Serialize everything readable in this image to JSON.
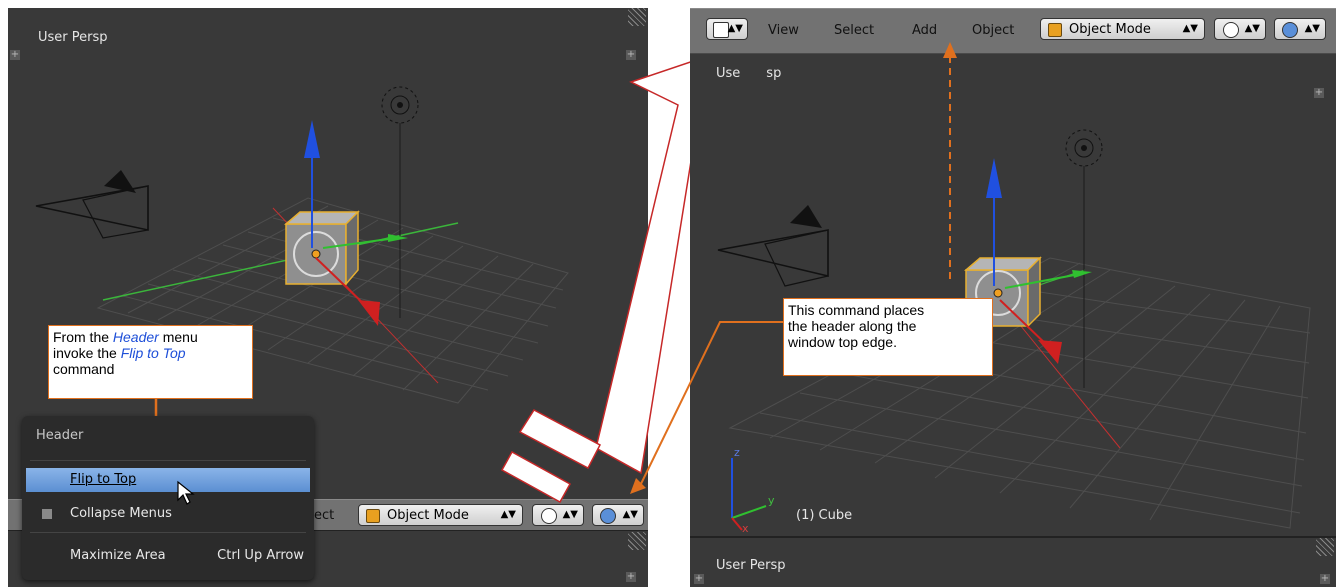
{
  "left_viewport": {
    "persp_label": "User Persp",
    "header_select_partial": "ect",
    "mode_label": "Object Mode",
    "bottom_area_label": ""
  },
  "popup": {
    "title": "Header",
    "items": [
      {
        "label": "Flip to Top",
        "shortcut": "",
        "selected": true
      },
      {
        "label": "Collapse Menus",
        "shortcut": "",
        "checkbox": true
      },
      {
        "label": "Maximize Area",
        "shortcut": "Ctrl Up Arrow"
      }
    ]
  },
  "callout_left": {
    "line1_pre": "From the ",
    "line1_em": "Header",
    "line1_post": " menu",
    "line2_pre": "invoke the ",
    "line2_em": "Flip to Top",
    "line3": "command"
  },
  "right_viewport": {
    "menu": [
      "View",
      "Select",
      "Add",
      "Object"
    ],
    "mode_label": "Object Mode",
    "persp_label_partial_a": "Use",
    "persp_label_partial_b": "sp",
    "object_label": "(1) Cube",
    "bottom_persp_label": "User Persp",
    "axis_z": "z",
    "axis_y": "y",
    "axis_x": "x"
  },
  "callout_right": {
    "text_line1": "This command places",
    "text_line2": "the header along the",
    "text_line3": "window top edge."
  },
  "colors": {
    "viewport_bg": "#393939",
    "header_bg": "#727272",
    "callout_border": "#e0701e",
    "emphasis_text": "#1e4fd8",
    "selected_item": "#7aa7e0"
  }
}
